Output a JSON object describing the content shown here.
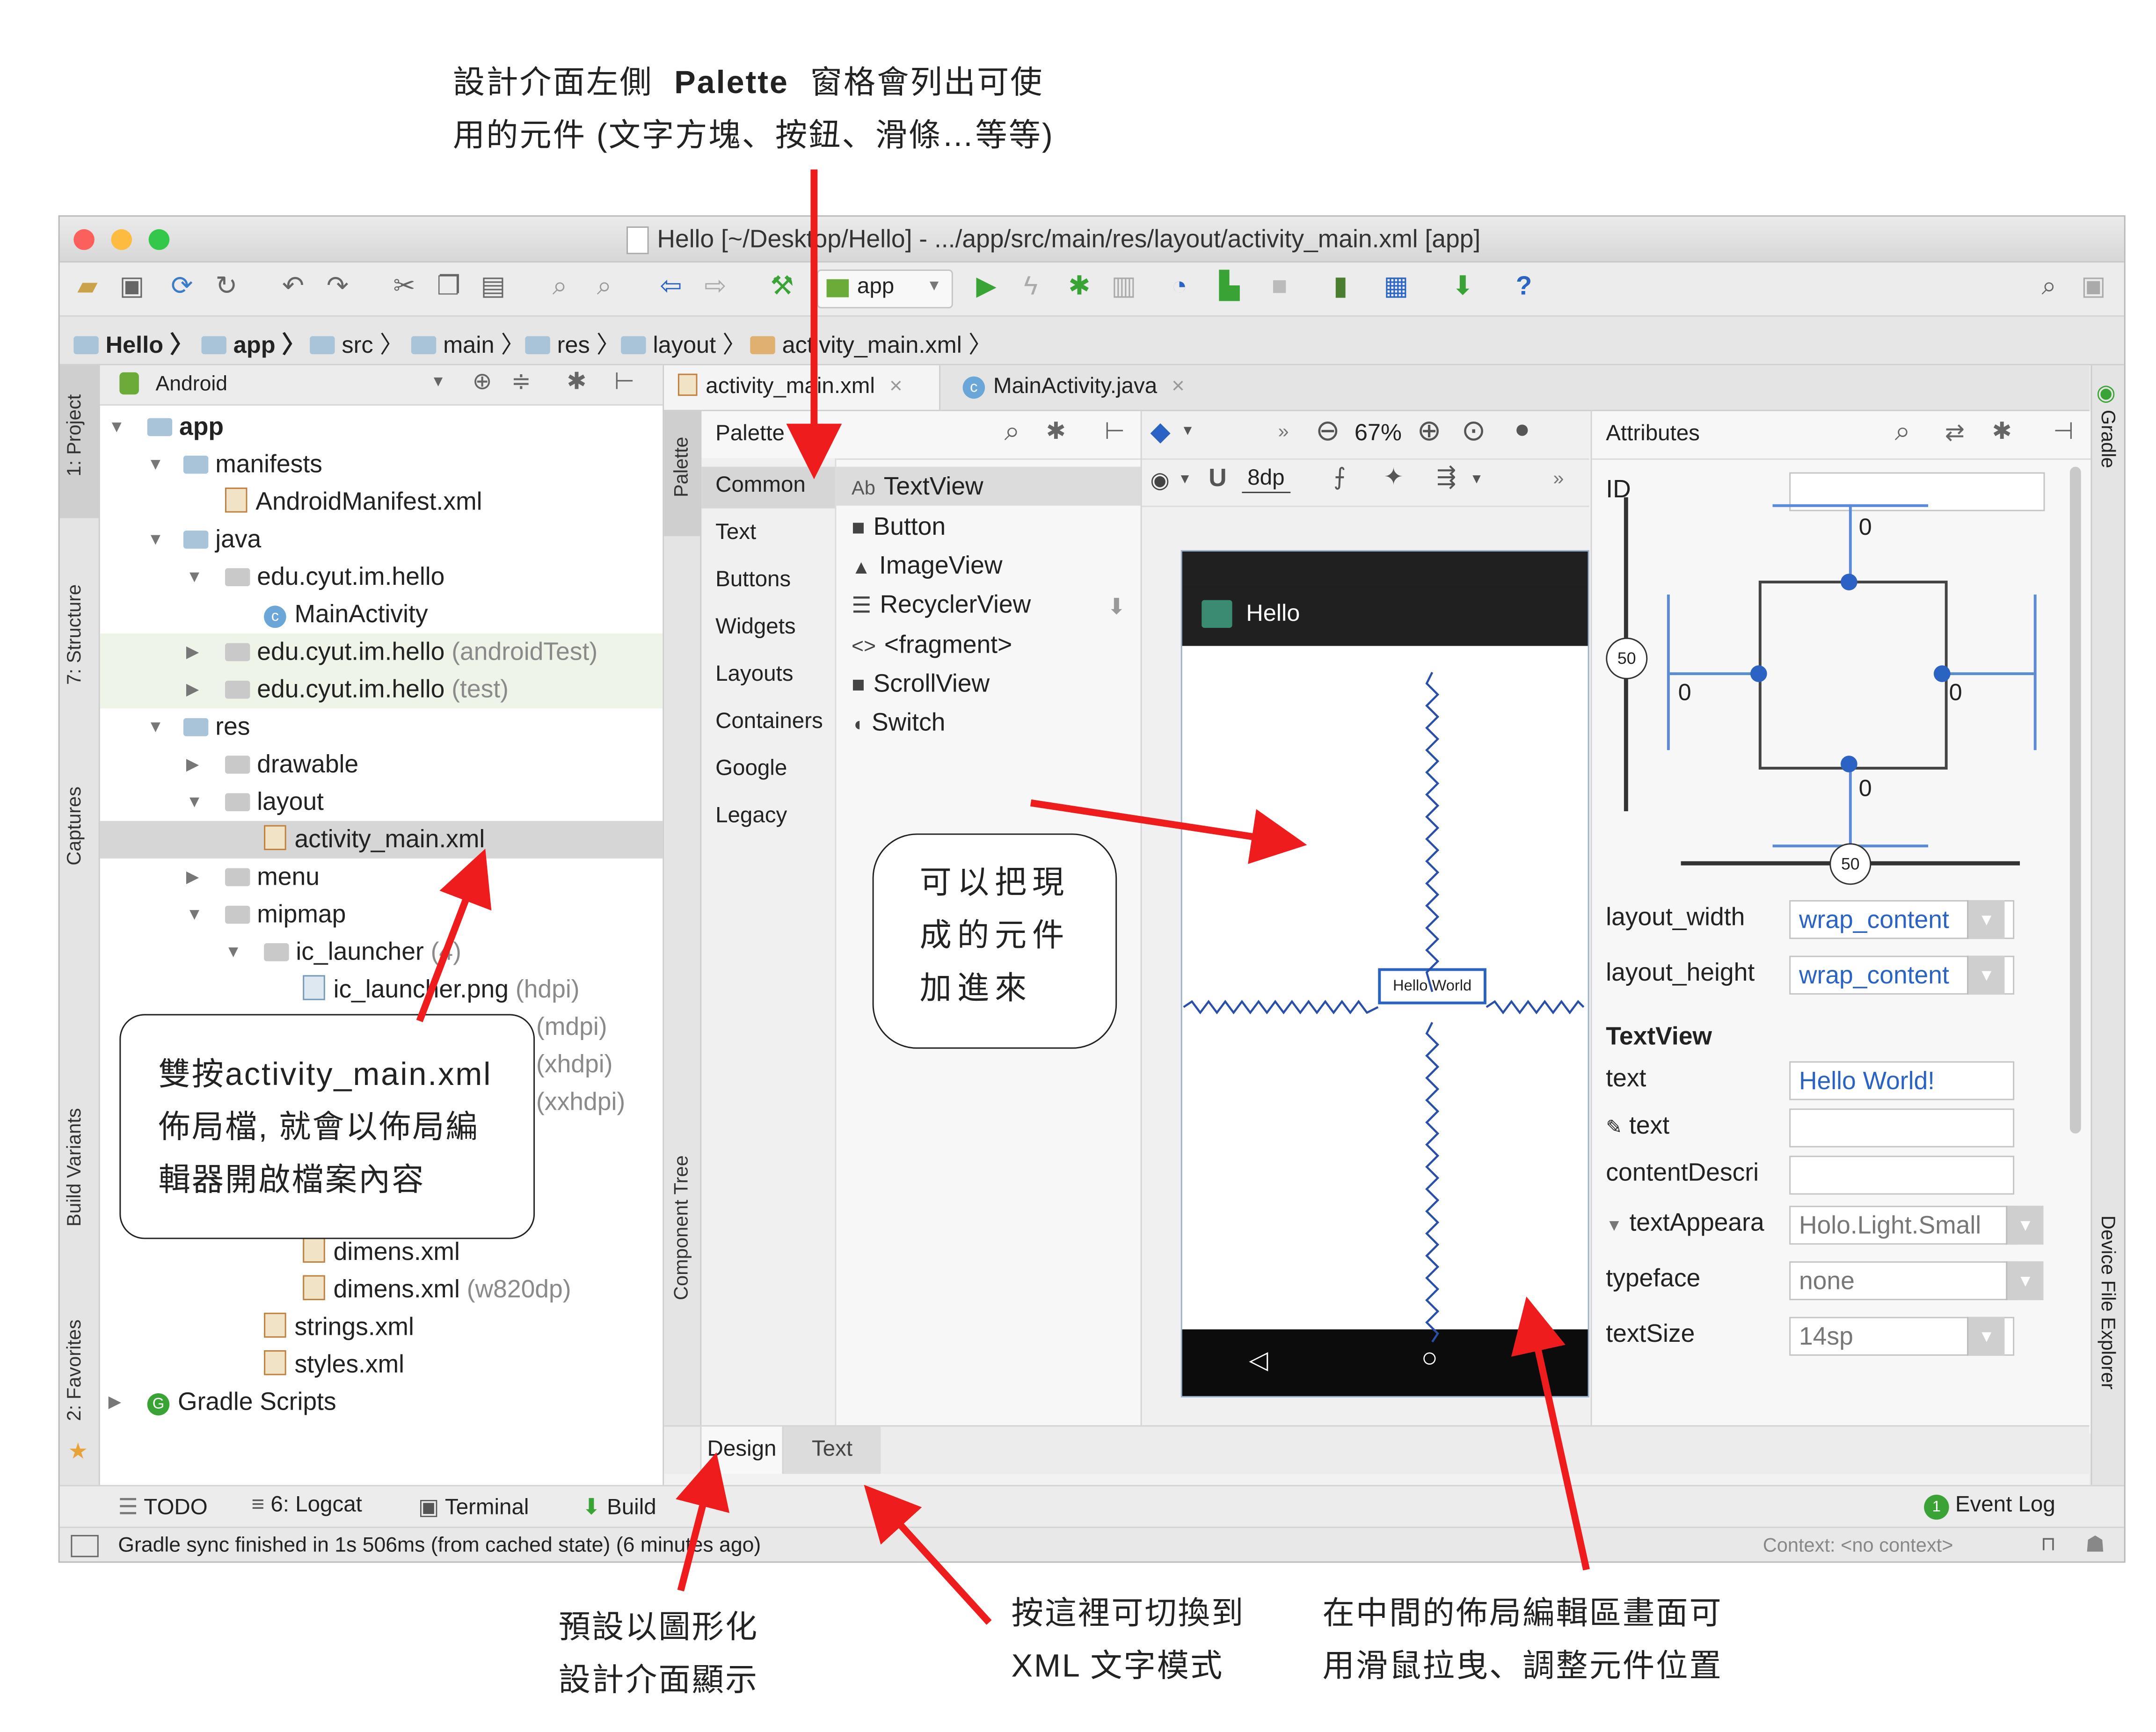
{
  "annotations": {
    "top_line1_pre": "設計介面左側",
    "top_line1_bold": "Palette",
    "top_line1_post": "窗格會列出可使",
    "top_line2": "用的元件 (文字方塊、按鈕、滑條…等等)",
    "double_click_lines": [
      "雙按activity_main.xml",
      "佈局檔, 就會以佈局編",
      "輯器開啟檔案內容"
    ],
    "add_lines": [
      "可以把現",
      "成的元件",
      "加進來"
    ],
    "default_lines": [
      "預設以圖形化",
      "設計介面顯示"
    ],
    "switch_lines": [
      "按這裡可切換到",
      "XML 文字模式"
    ],
    "center_lines": [
      "在中間的佈局編輯區畫面可",
      "用滑鼠拉曳、調整元件位置"
    ]
  },
  "window": {
    "title": "Hello [~/Desktop/Hello] - .../app/src/main/res/layout/activity_main.xml [app]",
    "run_config": "app"
  },
  "breadcrumb": [
    "Hello",
    "app",
    "src",
    "main",
    "res",
    "layout",
    "activity_main.xml"
  ],
  "left_strip": [
    "1: Project",
    "7: Structure",
    "Captures",
    "Build Variants",
    "2: Favorites"
  ],
  "project": {
    "view": "Android",
    "tree": {
      "app": "app",
      "manifests": "manifests",
      "manifest_file": "AndroidManifest.xml",
      "java": "java",
      "pkg1": "edu.cyut.im.hello",
      "main_activity": "MainActivity",
      "pkg2": "edu.cyut.im.hello",
      "pkg2_suffix": "(androidTest)",
      "pkg3": "edu.cyut.im.hello",
      "pkg3_suffix": "(test)",
      "res": "res",
      "drawable": "drawable",
      "layout": "layout",
      "activity_main": "activity_main.xml",
      "menu": "menu",
      "mipmap": "mipmap",
      "ic_launcher": "ic_launcher",
      "ic_launcher_count": "(4)",
      "ic_png": "ic_launcher.png",
      "hdpi": "(hdpi)",
      "mdpi": "(mdpi)",
      "xhdpi": "(xhdpi)",
      "xxhdpi": "(xxhdpi)",
      "dimens1": "dimens.xml",
      "dimens2": "dimens.xml",
      "dimens2_suffix": "(w820dp)",
      "strings": "strings.xml",
      "styles": "styles.xml",
      "gradle": "Gradle Scripts"
    }
  },
  "tabs": [
    {
      "label": "activity_main.xml"
    },
    {
      "label": "MainActivity.java"
    }
  ],
  "palette": {
    "strip_label": "Palette",
    "component_tree": "Component Tree",
    "title": "Palette",
    "categories": [
      "Common",
      "Text",
      "Buttons",
      "Widgets",
      "Layouts",
      "Containers",
      "Google",
      "Legacy"
    ],
    "items": [
      {
        "icon": "Ab",
        "label": "TextView"
      },
      {
        "icon": "■",
        "label": "Button"
      },
      {
        "icon": "▲",
        "label": "ImageView"
      },
      {
        "icon": "☰",
        "label": "RecyclerView"
      },
      {
        "icon": "<>",
        "label": "<fragment>"
      },
      {
        "icon": "■",
        "label": "ScrollView"
      },
      {
        "icon": "◖",
        "label": "Switch"
      }
    ]
  },
  "design": {
    "zoom": "67%",
    "margin": "8dp",
    "app_title": "Hello",
    "widget_text": "Hello World"
  },
  "attributes": {
    "title": "Attributes",
    "id_label": "ID",
    "margin_top": "0",
    "margin_left": "0",
    "margin_right": "0",
    "margin_bottom": "0",
    "bias_v": "50",
    "bias_h": "50",
    "layout_width_label": "layout_width",
    "layout_width_value": "wrap_content",
    "layout_height_label": "layout_height",
    "layout_height_value": "wrap_content",
    "section": "TextView",
    "text_label": "text",
    "text_value": "Hello World!",
    "tools_text_label": "text",
    "content_label": "contentDescri",
    "appearance_label": "textAppeara",
    "appearance_value": "Holo.Light.Small",
    "typeface_label": "typeface",
    "typeface_value": "none",
    "textsize_label": "textSize",
    "textsize_value": "14sp"
  },
  "right_strip": [
    "Gradle",
    "Device File Explorer"
  ],
  "bottom_tabs": [
    "Design",
    "Text"
  ],
  "tool_windows": [
    "TODO",
    "6: Logcat",
    "Terminal",
    "Build"
  ],
  "event_log": "Event Log",
  "event_count": "1",
  "status": {
    "message": "Gradle sync finished in 1s 506ms (from cached state) (6 minutes ago)",
    "context": "Context: <no context>"
  },
  "colors": {
    "arrow": "#ee1c1c",
    "accent_blue": "#2a63c4",
    "run_green": "#3aa335",
    "selection": "#d6d6d6"
  }
}
